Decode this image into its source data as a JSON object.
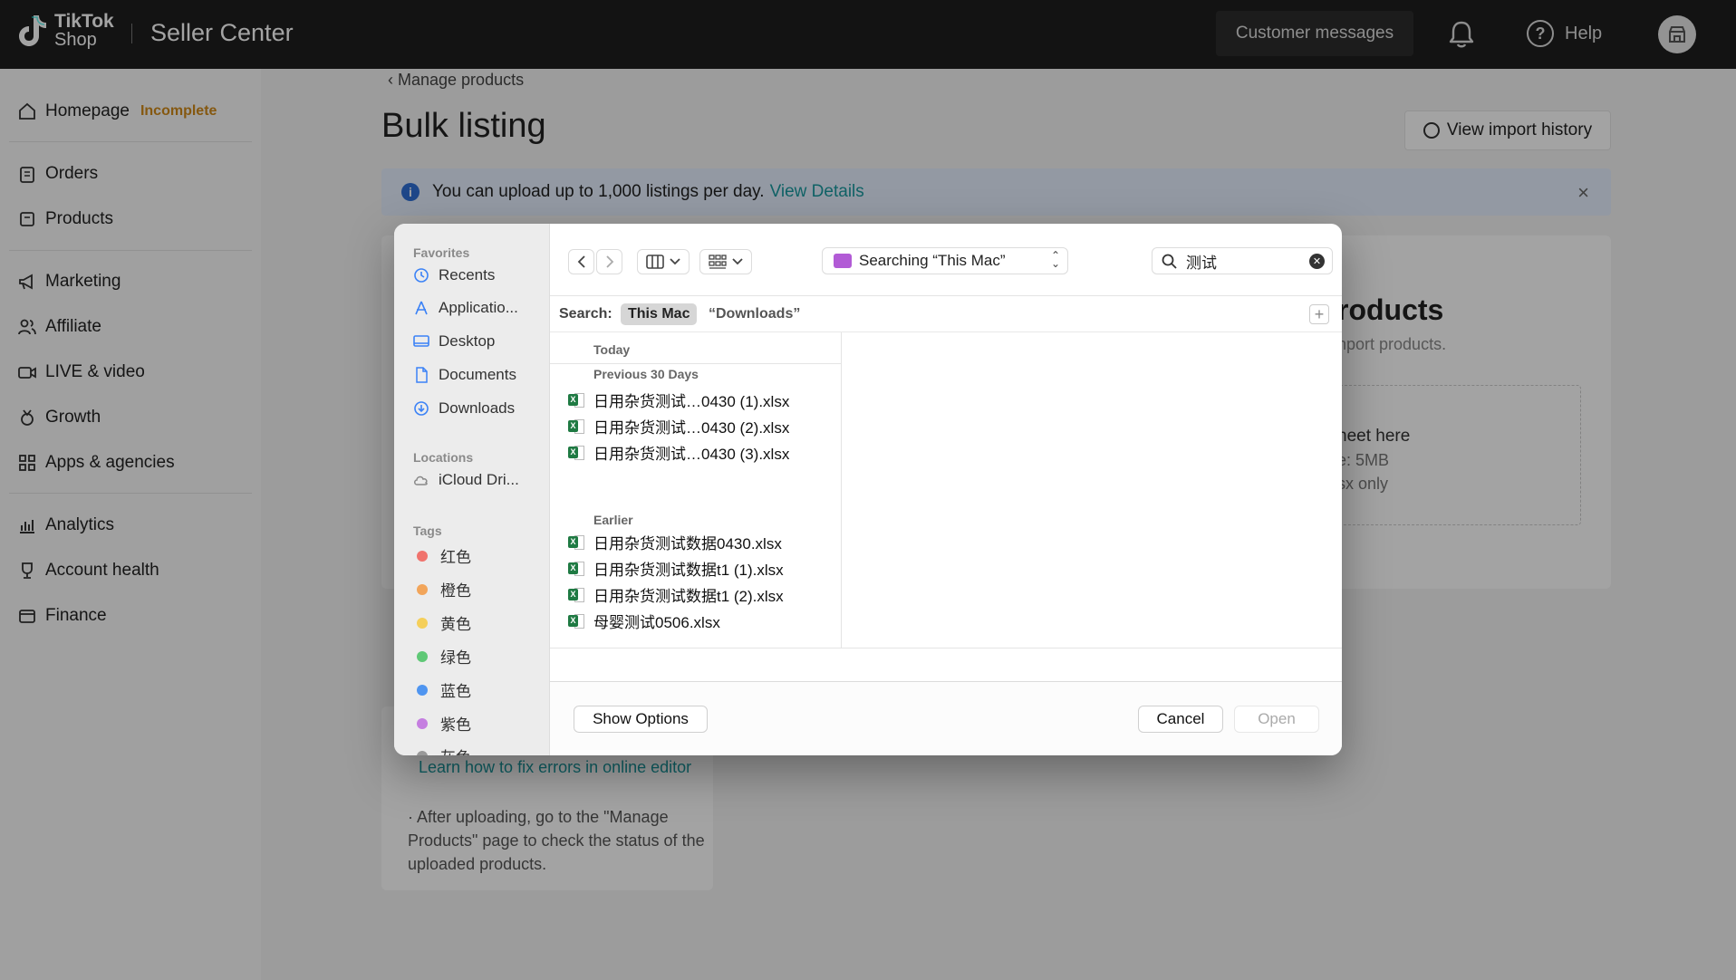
{
  "topbar": {
    "logo_line1": "TikTok",
    "logo_line2": "Shop",
    "title": "Seller Center",
    "customer_messages": "Customer messages",
    "help": "Help"
  },
  "sidebar": {
    "homepage": "Homepage",
    "homepage_badge": "Incomplete",
    "items": [
      "Orders",
      "Products",
      "Marketing",
      "Affiliate",
      "LIVE & video",
      "Growth",
      "Apps & agencies",
      "Analytics",
      "Account health",
      "Finance"
    ]
  },
  "main": {
    "breadcrumb": "Manage products",
    "title": "Bulk listing",
    "view_history": "View import history",
    "banner_text": "You can upload up to 1,000 listings per day.",
    "banner_link": "View Details",
    "card_title_partial": "roducts",
    "card_sub_partial": "nport products.",
    "dropzone_line1": "heet here",
    "dropzone_line2": "e: 5MB",
    "dropzone_line3": "sx only",
    "tip_link": "Learn how to fix errors in online editor",
    "tip_text": "· After uploading, go to the \"Manage Products\" page to check the status of the uploaded products."
  },
  "dialog": {
    "favorites_label": "Favorites",
    "favorites": [
      "Recents",
      "Applicatio...",
      "Desktop",
      "Documents",
      "Downloads"
    ],
    "locations_label": "Locations",
    "locations": [
      "iCloud Dri..."
    ],
    "tags_label": "Tags",
    "tags": [
      {
        "name": "红色",
        "color": "#f0736d"
      },
      {
        "name": "橙色",
        "color": "#f2a55a"
      },
      {
        "name": "黄色",
        "color": "#f5cf5a"
      },
      {
        "name": "绿色",
        "color": "#5fc876"
      },
      {
        "name": "蓝色",
        "color": "#4f95f0"
      },
      {
        "name": "紫色",
        "color": "#c57ee0"
      },
      {
        "name": "灰色",
        "color": "#999999"
      }
    ],
    "location_select": "Searching “This Mac”",
    "search_value": "测试",
    "scope_label": "Search:",
    "scope_this_mac": "This Mac",
    "scope_downloads": "“Downloads”",
    "groups": {
      "today": "Today",
      "previous": "Previous 30 Days",
      "earlier": "Earlier"
    },
    "files_previous": [
      "日用杂货测试…0430 (1).xlsx",
      "日用杂货测试…0430 (2).xlsx",
      "日用杂货测试…0430 (3).xlsx"
    ],
    "files_earlier": [
      "日用杂货测试数据0430.xlsx",
      "日用杂货测试数据t1 (1).xlsx",
      "日用杂货测试数据t1 (2).xlsx",
      "母婴测试0506.xlsx"
    ],
    "show_options": "Show Options",
    "cancel": "Cancel",
    "open": "Open"
  }
}
